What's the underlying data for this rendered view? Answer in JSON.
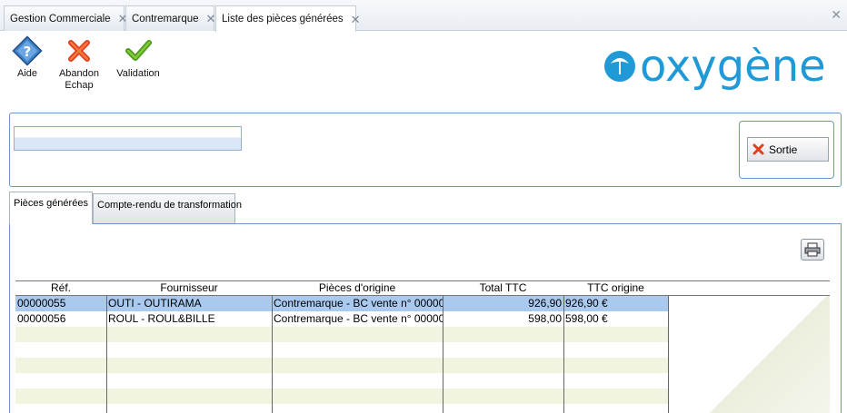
{
  "tabs": [
    {
      "label": "Gestion Commerciale"
    },
    {
      "label": "Contremarque"
    },
    {
      "label": "Liste des pièces générées"
    }
  ],
  "toolbar": {
    "aide": "Aide",
    "abandon_line1": "Abandon",
    "abandon_line2": "Echap",
    "validation": "Validation"
  },
  "logo": "oxygène",
  "colors": {
    "accent": "#1f9ad6",
    "panel_border": "#6f95c6",
    "selected_row": "#a9c9ef",
    "alt_row": "#f1f4df"
  },
  "header": {
    "field_value": "",
    "sortie_label": "Sortie"
  },
  "section_tabs": [
    {
      "label": "Pièces générées"
    },
    {
      "label": "Compte-rendu de transformation"
    }
  ],
  "grid": {
    "columns": [
      "Réf.",
      "Fournisseur",
      "Pièces d'origine",
      "Total TTC",
      "TTC origine"
    ],
    "rows": [
      {
        "ref": "00000055",
        "fournisseur": "OUTI - OUTIRAMA",
        "origine": "Contremarque - BC vente n° 00000",
        "total": "926,90",
        "ttc_origine": "926,90 €"
      },
      {
        "ref": "00000056",
        "fournisseur": "ROUL - ROUL&BILLE",
        "origine": "Contremarque - BC vente n° 00000",
        "total": "598,00",
        "ttc_origine": "598,00 €"
      }
    ]
  }
}
